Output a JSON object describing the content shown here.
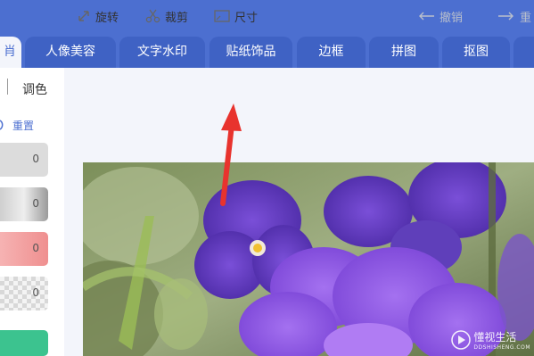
{
  "tabs": [
    {
      "label": "肖"
    },
    {
      "label": "人像美容"
    },
    {
      "label": "文字水印"
    },
    {
      "label": "贴纸饰品"
    },
    {
      "label": "边框"
    },
    {
      "label": "拼图"
    },
    {
      "label": "抠图"
    },
    {
      "label": ""
    }
  ],
  "toolbar": {
    "rotate": "旋转",
    "crop": "裁剪",
    "size": "尺寸",
    "undo": "撤销",
    "redo": "重"
  },
  "sidebar": {
    "tone_label": "调色",
    "reset_label": "重置",
    "sliders": [
      {
        "value": "0",
        "color": "#d9d9d9"
      },
      {
        "value": "0",
        "color": "#c8c8c8"
      },
      {
        "value": "0",
        "color": "#f08d8d"
      },
      {
        "value": "0",
        "color": "#e6e6e6"
      },
      {
        "value": "",
        "color": "#3cc38f"
      }
    ]
  },
  "watermark": {
    "text": "懂视生活",
    "sub": "DDSHISHENG.COM"
  },
  "colors": {
    "accent": "#4c6fd0",
    "tab_bg": "#3f62c4",
    "annotation_arrow": "#e8332e"
  }
}
